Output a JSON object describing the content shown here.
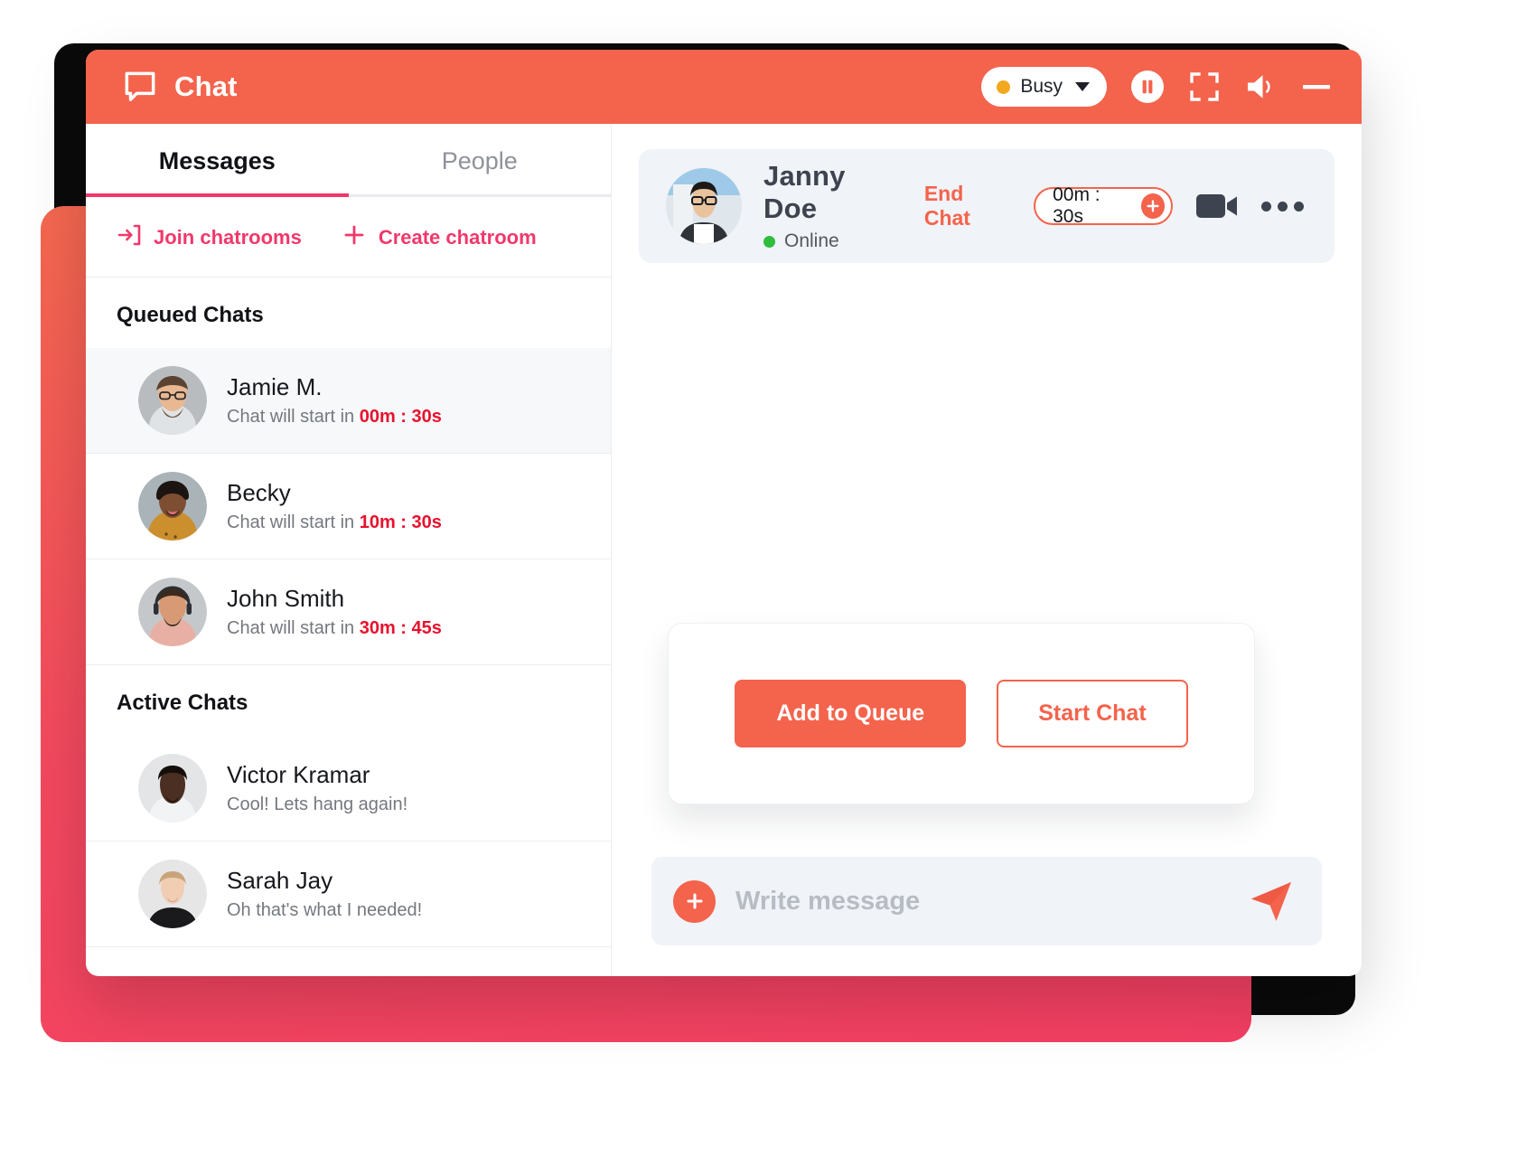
{
  "window": {
    "title": "Chat",
    "title_icon": "chat-bubble-icon",
    "accent_orange": "#f4634c",
    "accent_pink": "#f0386b",
    "timer_red": "#e8112d"
  },
  "titlebar": {
    "status": {
      "label": "Busy",
      "dot_color": "#f2a81d",
      "caret_icon": "chevron-down-icon"
    },
    "controls": [
      {
        "icon": "pause-icon"
      },
      {
        "icon": "expand-icon"
      },
      {
        "icon": "speaker-icon"
      },
      {
        "icon": "minimize-icon"
      }
    ]
  },
  "sidebar": {
    "tabs": [
      {
        "label": "Messages",
        "active": true
      },
      {
        "label": "People",
        "active": false
      }
    ],
    "quick_actions": [
      {
        "label": "Join chatrooms",
        "icon": "join-arrow-icon"
      },
      {
        "label": "Create chatroom",
        "icon": "plus-icon"
      }
    ],
    "sections": [
      {
        "title": "Queued Chats",
        "rows": [
          {
            "name": "Jamie M.",
            "sub_prefix": "Chat will start in ",
            "timer": "00m : 30s",
            "selected": true,
            "avatar": "avatar-jamie"
          },
          {
            "name": "Becky",
            "sub_prefix": "Chat will start in ",
            "timer": "10m : 30s",
            "selected": false,
            "avatar": "avatar-becky"
          },
          {
            "name": "John Smith",
            "sub_prefix": "Chat will start in ",
            "timer": "30m : 45s",
            "selected": false,
            "avatar": "avatar-john"
          }
        ]
      },
      {
        "title": "Active Chats",
        "rows": [
          {
            "name": "Victor Kramar",
            "sub_prefix": "Cool! Lets hang again!",
            "timer": "",
            "selected": false,
            "avatar": "avatar-victor"
          },
          {
            "name": "Sarah Jay",
            "sub_prefix": "Oh that's what I needed!",
            "timer": "",
            "selected": false,
            "avatar": "avatar-sarah"
          }
        ]
      }
    ]
  },
  "conversation": {
    "name": "Janny Doe",
    "status": "Online",
    "status_dot_color": "#2fbd3d",
    "end_chat_label": "End Chat",
    "timer": "00m : 30s",
    "timer_plus_icon": "plus-circle-icon",
    "video_icon": "video-camera-icon",
    "more_icon": "ellipsis-icon",
    "avatar": "avatar-janny"
  },
  "action_card": {
    "primary_label": "Add to Queue",
    "secondary_label": "Start Chat"
  },
  "composer": {
    "attach_icon": "plus-icon",
    "placeholder": "Write message",
    "value": "",
    "send_icon": "send-paper-plane-icon"
  }
}
